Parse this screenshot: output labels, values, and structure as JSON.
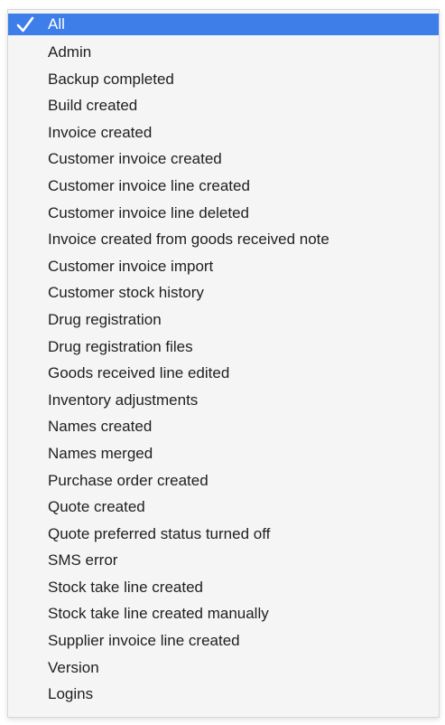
{
  "menu": {
    "selected_index": 0,
    "items": [
      "All",
      "Admin",
      "Backup completed",
      "Build created",
      "Invoice created",
      "Customer invoice created",
      "Customer invoice line created",
      "Customer invoice line deleted",
      "Invoice created from goods received note",
      "Customer invoice import",
      "Customer stock history",
      "Drug registration",
      "Drug registration files",
      "Goods received line edited",
      "Inventory adjustments",
      "Names created",
      "Names merged",
      "Purchase order created",
      "Quote created",
      "Quote preferred status turned off",
      "SMS error",
      "Stock take line created",
      "Stock take line created manually",
      "Supplier invoice line created",
      "Version",
      "Logins"
    ]
  },
  "colors": {
    "selection": "#3d7ee8",
    "text": "#1f1f1f"
  },
  "icons": {
    "selected_marker": "checkmark-icon"
  }
}
